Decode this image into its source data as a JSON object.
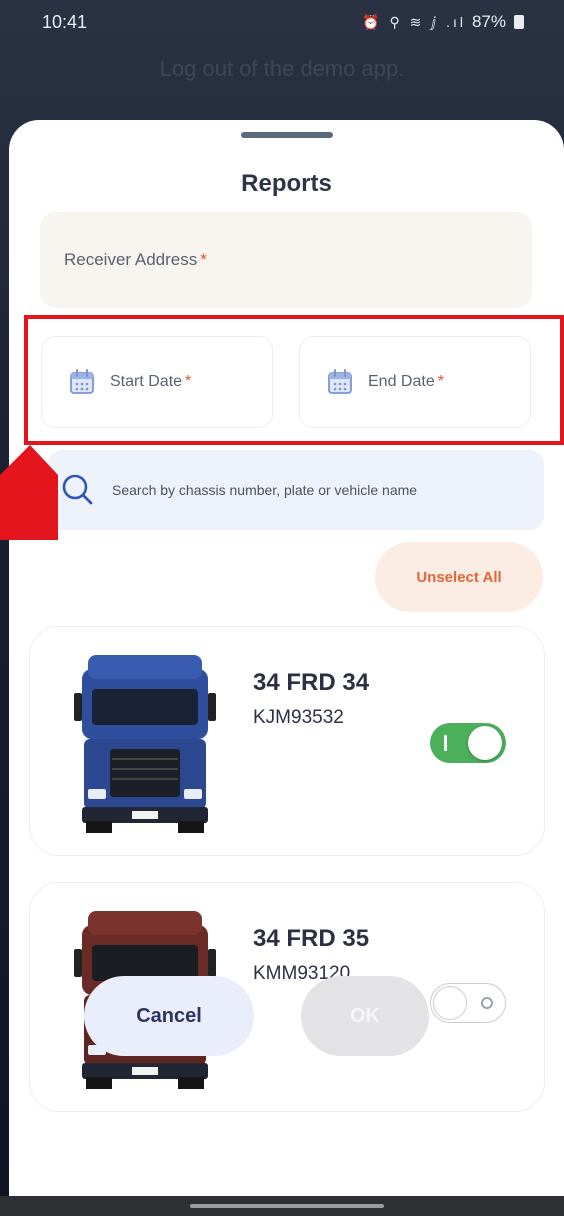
{
  "status_bar": {
    "time": "10:41",
    "icons": "⏰ ⚲ ≋ ⅉ .ıl",
    "battery": "87%"
  },
  "background": {
    "hint_text": "Log out of the demo app."
  },
  "sheet": {
    "title": "Reports",
    "receiver": {
      "label": "Receiver Address",
      "required_mark": "*"
    },
    "start_date": {
      "label": "Start Date",
      "required_mark": "*",
      "icon": "calendar-icon"
    },
    "end_date": {
      "label": "End Date",
      "required_mark": "*",
      "icon": "calendar-icon"
    },
    "search": {
      "placeholder": "Search by chassis number, plate or vehicle name",
      "icon": "search-icon"
    },
    "unselect_all": "Unselect All",
    "vehicles": [
      {
        "plate": "34 FRD 34",
        "chassis": "KJM93532",
        "selected": true,
        "color": "#2f4f9e"
      },
      {
        "plate": "34 FRD 35",
        "chassis": "KMM93120",
        "selected": false,
        "color": "#6a2a26"
      }
    ],
    "cancel": "Cancel",
    "ok": "OK"
  },
  "colors": {
    "accent_orange": "#e2663a",
    "toggle_on": "#4cb05a",
    "highlight_red": "#e4151c",
    "cancel_text": "#2a3560"
  }
}
